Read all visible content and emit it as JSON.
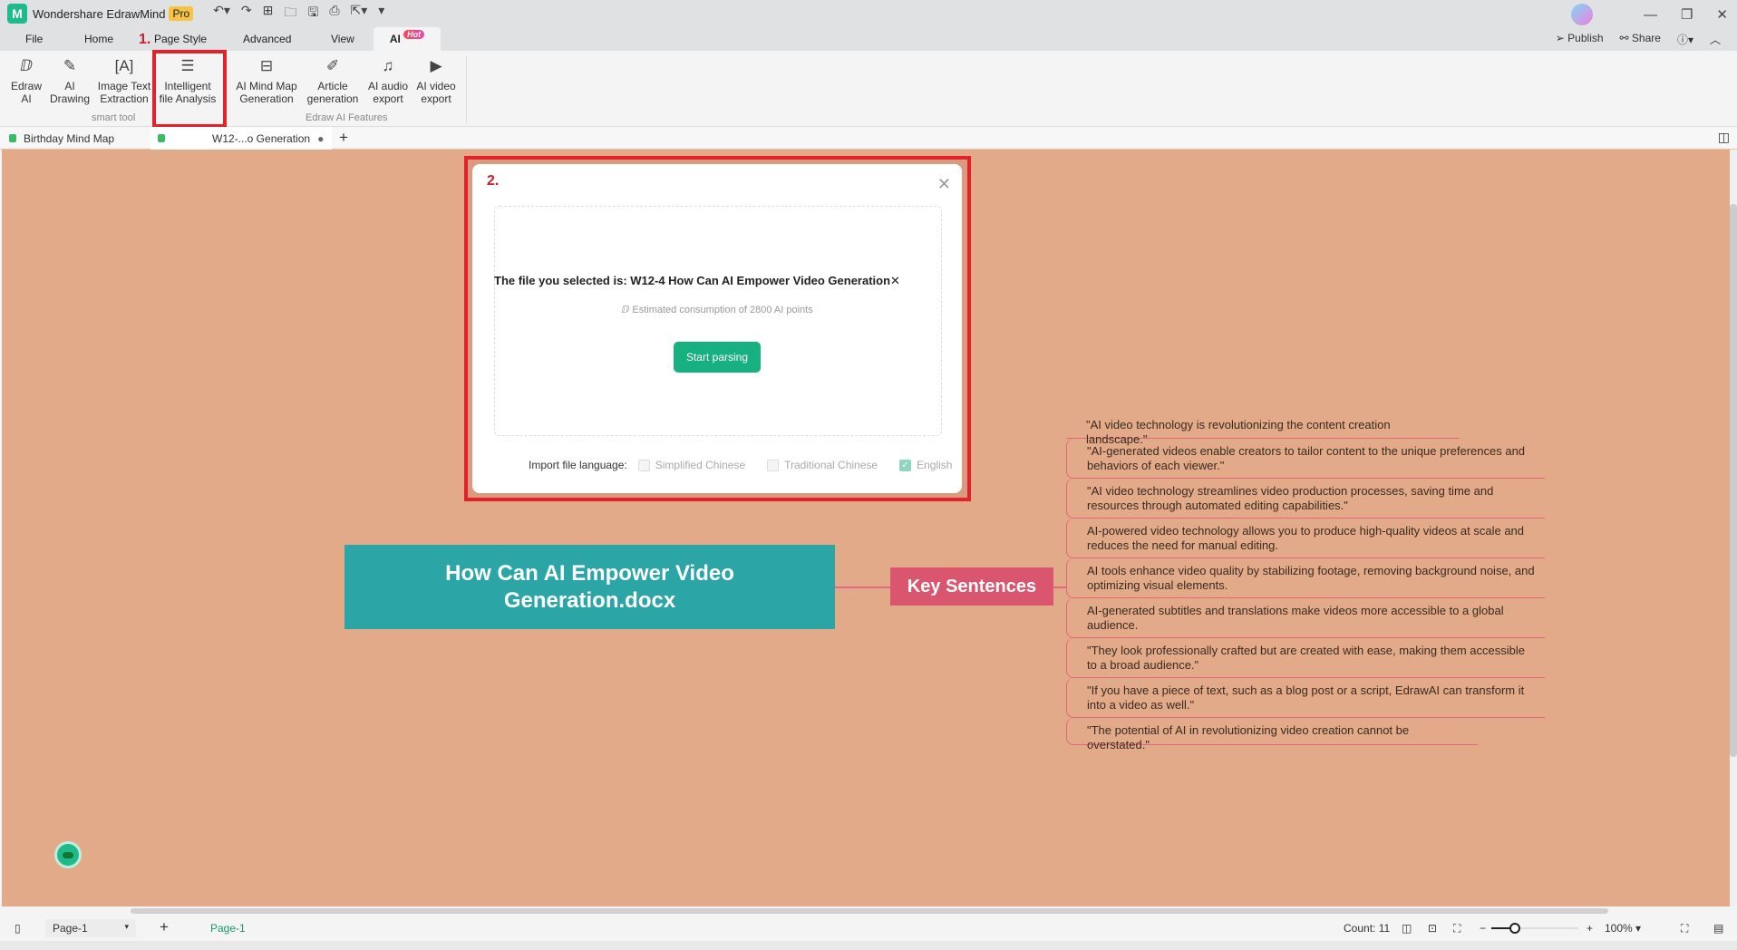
{
  "app": {
    "name": "Wondershare EdrawMind",
    "badge": "Pro"
  },
  "menu": {
    "items": [
      "File",
      "Home",
      "Page Style",
      "Advanced",
      "View"
    ],
    "ai_tab": "AI",
    "hot_badge": "Hot",
    "publish": "Publish",
    "share": "Share"
  },
  "ribbon": {
    "buttons": [
      {
        "label1": "Edraw",
        "label2": "AI",
        "icon": "edraw-ai-icon"
      },
      {
        "label1": "AI",
        "label2": "Drawing",
        "icon": "ai-drawing-icon"
      },
      {
        "label1": "Image Text",
        "label2": "Extraction",
        "icon": "image-text-icon"
      },
      {
        "label1": "Intelligent",
        "label2": "file Analysis",
        "icon": "file-analysis-icon"
      },
      {
        "label1": "AI Mind Map",
        "label2": "Generation",
        "icon": "mindmap-gen-icon"
      },
      {
        "label1": "Article",
        "label2": "generation",
        "icon": "article-icon"
      },
      {
        "label1": "AI audio",
        "label2": "export",
        "icon": "audio-icon"
      },
      {
        "label1": "AI video",
        "label2": "export",
        "icon": "video-icon"
      }
    ],
    "group_smart": "smart tool",
    "group_ai": "Edraw AI Features"
  },
  "annotations": {
    "step1": "1.",
    "step2": "2.",
    "accent": "#e3212a"
  },
  "tabs": [
    {
      "label": "Birthday Mind Map"
    },
    {
      "label": "W12-...o Generation"
    }
  ],
  "mindmap": {
    "central": "How Can AI Empower Video Generation.docx",
    "branch": "Key Sentences",
    "leaves": [
      "\"AI video technology is revolutionizing the content creation landscape.\"",
      "\"AI-generated videos enable creators to tailor content to the unique preferences and behaviors of each viewer.\"",
      "\"AI video technology streamlines video production processes, saving time and resources through automated editing capabilities.\"",
      "AI-powered video technology allows you to produce high-quality videos at scale and reduces the need for manual editing.",
      "AI tools enhance video quality by stabilizing footage, removing background noise, and optimizing visual elements.",
      "AI-generated subtitles and translations make videos more accessible to a global audience.",
      "\"They look professionally crafted but are created with ease, making them accessible to a broad audience.\"",
      "\"If you have a piece of text, such as a blog post or a script, EdrawAI can transform it into a video as well.\"",
      "\"The potential of AI in revolutionizing video creation cannot be overstated.\""
    ],
    "colors": {
      "canvas": "#e2aa88",
      "central": "#2ba5a5",
      "branch": "#d9566e"
    }
  },
  "dialog": {
    "selected": "The file you selected is: W12-4 How Can AI Empower Video Generation",
    "estimate": "Estimated consumption of 2800 AI points",
    "start": "Start parsing",
    "lang_label": "Import file language:",
    "langs": [
      {
        "label": "Simplified Chinese",
        "checked": false
      },
      {
        "label": "Traditional Chinese",
        "checked": false
      },
      {
        "label": "English",
        "checked": true
      }
    ]
  },
  "status": {
    "page_select": "Page-1",
    "page_tab": "Page-1",
    "count": "Count: 11",
    "zoom": "100%"
  }
}
